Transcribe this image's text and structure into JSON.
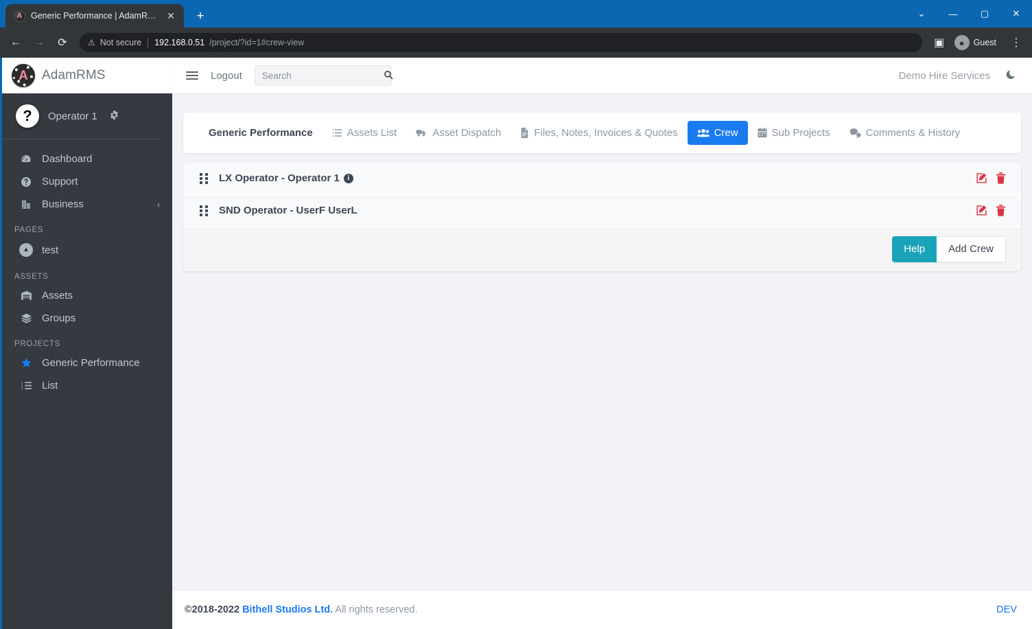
{
  "browser": {
    "tab": {
      "favicon_letter": "A",
      "title": "Generic Performance | AdamRMS",
      "close_icon": "✕"
    },
    "new_tab_icon": "+",
    "window_controls": {
      "minimize_chevron": "⌄",
      "minimize": "—",
      "maximize": "▢",
      "close": "✕"
    },
    "nav": {
      "back": "←",
      "forward": "→",
      "reload": "⟳"
    },
    "omnibox": {
      "warning_icon": "⚠",
      "security_label": "Not secure",
      "url_host": "192.168.0.51",
      "url_path": "/project/?id=1#crew-view"
    },
    "sidepanel_icon": "▣",
    "profile": {
      "label": "Guest",
      "avatar_glyph": "●"
    },
    "menu_icon": "⋮"
  },
  "sidebar": {
    "brand": {
      "logo_letter": "A",
      "name": "AdamRMS"
    },
    "user": {
      "avatar_glyph": "?",
      "name": "Operator 1",
      "settings_icon": "gear"
    },
    "groups": [
      {
        "heading": null,
        "items": [
          {
            "label": "Dashboard",
            "icon": "dashboard-icon"
          },
          {
            "label": "Support",
            "icon": "question-circle-icon"
          },
          {
            "label": "Business",
            "icon": "building-icon",
            "chevron": "‹"
          }
        ]
      },
      {
        "heading": "PAGES",
        "items": [
          {
            "label": "test",
            "icon": "page-circle-icon"
          }
        ]
      },
      {
        "heading": "ASSETS",
        "items": [
          {
            "label": "Assets",
            "icon": "warehouse-icon"
          },
          {
            "label": "Groups",
            "icon": "layers-icon"
          }
        ]
      },
      {
        "heading": "PROJECTS",
        "items": [
          {
            "label": "Generic Performance",
            "icon": "star-icon"
          },
          {
            "label": "List",
            "icon": "ordered-list-icon"
          }
        ]
      }
    ]
  },
  "topbar": {
    "menu_toggle_icon": "hamburger-icon",
    "logout_label": "Logout",
    "search": {
      "placeholder": "Search",
      "value": "",
      "icon": "search-icon"
    },
    "org_name": "Demo Hire Services",
    "theme_toggle_icon": "moon-icon"
  },
  "project_tabs": {
    "title": "Generic Performance",
    "items": [
      {
        "label": "Assets List",
        "icon": "list-icon",
        "active": false
      },
      {
        "label": "Asset Dispatch",
        "icon": "truck-icon",
        "active": false
      },
      {
        "label": "Files, Notes, Invoices & Quotes",
        "icon": "file-icon",
        "active": false
      },
      {
        "label": "Crew",
        "icon": "users-icon",
        "active": true
      },
      {
        "label": "Sub Projects",
        "icon": "calendar-icon",
        "active": false
      },
      {
        "label": "Comments & History",
        "icon": "comments-icon",
        "active": false
      }
    ]
  },
  "crew": {
    "rows": [
      {
        "label": "LX Operator - Operator 1",
        "has_info": true,
        "edit_icon": "edit-icon",
        "delete_icon": "trash-icon"
      },
      {
        "label": "SND Operator - UserF UserL",
        "has_info": false,
        "edit_icon": "edit-icon",
        "delete_icon": "trash-icon"
      }
    ],
    "buttons": {
      "help": "Help",
      "add_crew": "Add Crew"
    }
  },
  "footer": {
    "copyright": "©2018-2022 ",
    "company": "Bithell Studios Ltd.",
    "rights": " All rights reserved.",
    "env_badge": "DEV"
  },
  "colors": {
    "browser_blue": "#0b67b2",
    "sidebar_dark": "#343a40",
    "accent_blue": "#1a7bf0",
    "help_teal": "#1aa3b8",
    "danger_red": "#dc3545",
    "page_bg": "#f1f3f8"
  }
}
